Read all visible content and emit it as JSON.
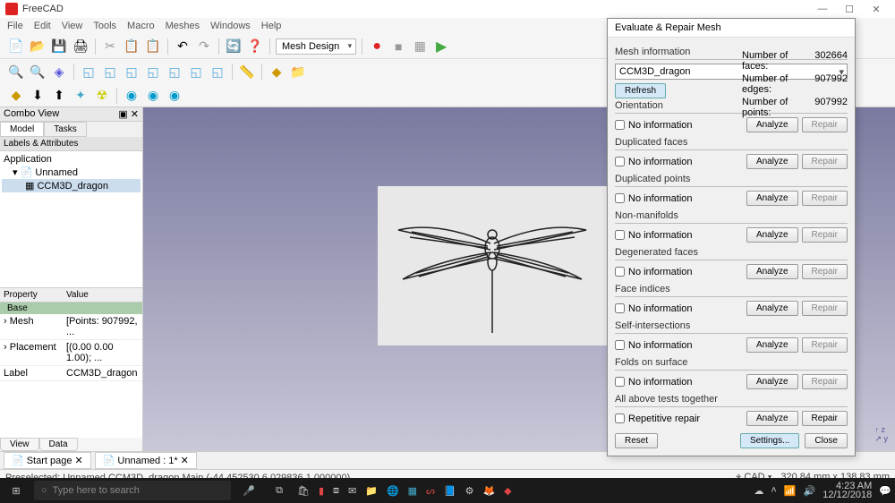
{
  "title": "FreeCAD",
  "menu": [
    "File",
    "Edit",
    "View",
    "Tools",
    "Macro",
    "Meshes",
    "Windows",
    "Help"
  ],
  "workbench": "Mesh Design",
  "combo": {
    "title": "Combo View",
    "tabs": [
      "Model",
      "Tasks"
    ],
    "labels_header": "Labels & Attributes",
    "app_label": "Application",
    "doc_label": "Unnamed",
    "obj_label": "CCM3D_dragon",
    "prop_header": "Property",
    "value_header": "Value",
    "base_label": "Base",
    "rows": [
      {
        "p": "Mesh",
        "v": "[Points: 907992, ..."
      },
      {
        "p": "Placement",
        "v": "[(0.00 0.00 1.00); ..."
      },
      {
        "p": "Label",
        "v": "CCM3D_dragon"
      }
    ],
    "bottom_tabs": [
      "View",
      "Data"
    ]
  },
  "doc_tabs": [
    {
      "icon": "📄",
      "label": "Start page",
      "close": "✕"
    },
    {
      "icon": "📄",
      "label": "Unnamed : 1*",
      "close": "✕"
    }
  ],
  "statusbar": {
    "left": "Preselected: Unnamed.CCM3D_dragon.Main (-44.452530,6.029836,1.000000)",
    "cad": "CAD",
    "dims": "320.84 mm x 138.83 mm"
  },
  "dialog": {
    "title": "Evaluate & Repair Mesh",
    "mesh_info_label": "Mesh information",
    "mesh_name": "CCM3D_dragon",
    "refresh": "Refresh",
    "stats": [
      {
        "k": "Number of faces:",
        "v": "302664"
      },
      {
        "k": "Number of edges:",
        "v": "907992"
      },
      {
        "k": "Number of points:",
        "v": "907992"
      }
    ],
    "sections": [
      "Orientation",
      "Duplicated faces",
      "Duplicated points",
      "Non-manifolds",
      "Degenerated faces",
      "Face indices",
      "Self-intersections",
      "Folds on surface"
    ],
    "no_info": "No information",
    "analyze": "Analyze",
    "repair": "Repair",
    "all_tests": "All above tests together",
    "repetitive": "Repetitive repair",
    "reset": "Reset",
    "settings": "Settings...",
    "close": "Close"
  },
  "taskbar": {
    "search_placeholder": "Type here to search",
    "time": "4:23 AM",
    "date": "12/12/2018"
  }
}
